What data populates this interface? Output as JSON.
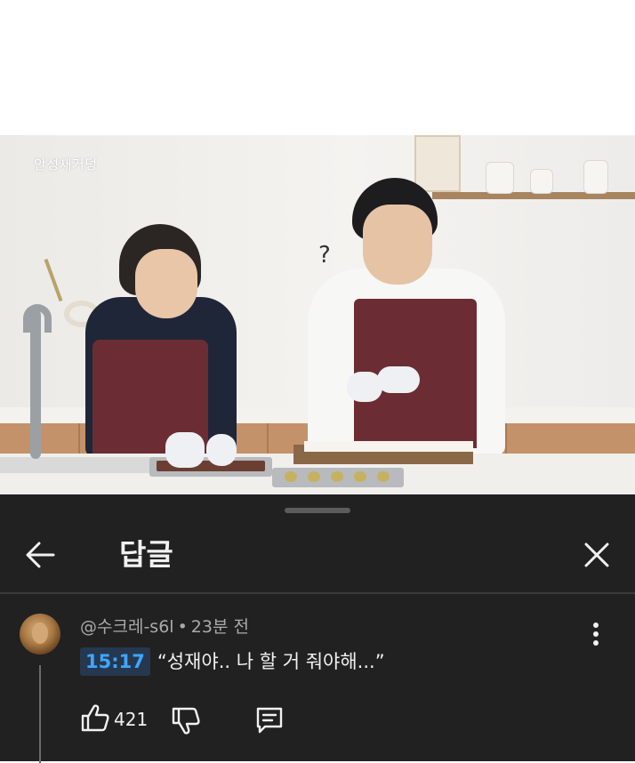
{
  "video": {
    "channel_watermark": "안성재거덩",
    "caption_mark": "?"
  },
  "sheet": {
    "title": "답글",
    "icons": {
      "back": "arrow-left-icon",
      "close": "close-x-icon",
      "more": "more-vert-icon"
    }
  },
  "comment": {
    "author": "@수크레-s6l",
    "separator": "•",
    "time_ago": "23분 전",
    "timestamp_link": "15:17",
    "text": "“성재야.. 나 할 거 줘야해...”",
    "like_count": "421",
    "icons": {
      "like": "thumbs-up-icon",
      "dislike": "thumbs-down-icon",
      "reply": "reply-comment-icon"
    }
  },
  "colors": {
    "sheet_bg": "#212121",
    "timestamp_link": "#3ea6ff",
    "timestamp_bg": "#263850",
    "text_primary": "#f1f1f1",
    "text_secondary": "#aaaaaa"
  }
}
